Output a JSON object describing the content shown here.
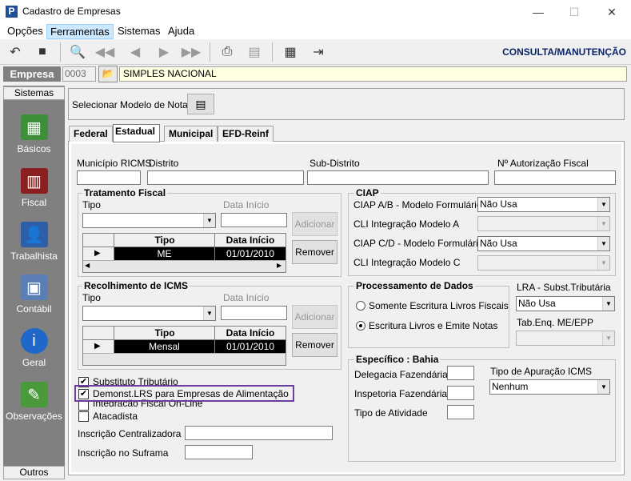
{
  "window": {
    "title": "Cadastro de Empresas",
    "minimize": "—",
    "maximize": "☐",
    "close": "✕"
  },
  "menu": [
    "Opções",
    "Ferramentas",
    "Sistemas",
    "Ajuda"
  ],
  "toolbar": {
    "mode": "CONSULTA/MANUTENÇÃO"
  },
  "empresa": {
    "label": "Empresa",
    "code": "0003",
    "name": "SIMPLES NACIONAL"
  },
  "sidebar": {
    "header": "Sistemas",
    "footer": "Outros",
    "items": [
      "Básicos",
      "Fiscal",
      "Trabalhista",
      "Contábil",
      "Geral",
      "Observações"
    ]
  },
  "modelo": {
    "label": "Selecionar Modelo de Nota"
  },
  "tabs": [
    "Federal",
    "Estadual",
    "Municipal",
    "EFD-Reinf"
  ],
  "fields": {
    "municipio_ricms": "Município RICMS",
    "distrito": "Distrito",
    "sub_distrito": "Sub-Distrito",
    "autorizacao": "Nº Autorização Fiscal"
  },
  "tratamento": {
    "title": "Tratamento Fiscal",
    "tipo": "Tipo",
    "data_inicio": "Data Início",
    "add": "Adicionar",
    "remove": "Remover",
    "col_tipo": "Tipo",
    "col_data": "Data Início",
    "row_tipo": "ME",
    "row_data": "01/01/2010"
  },
  "recolhimento": {
    "title": "Recolhimento de ICMS",
    "tipo": "Tipo",
    "data_inicio": "Data Início",
    "add": "Adicionar",
    "remove": "Remover",
    "col_tipo": "Tipo",
    "col_data": "Data Início",
    "row_tipo": "Mensal",
    "row_data": "01/01/2010"
  },
  "ciap": {
    "title": "CIAP",
    "ab_label": "CIAP  A/B - Modelo Formulário",
    "ab_value": "Não Usa",
    "cli_a": "CLI Integração Modelo A",
    "cd_label": "CIAP C/D - Modelo Formulário",
    "cd_value": "Não Usa",
    "cli_c": "CLI Integração Modelo C"
  },
  "processamento": {
    "title": "Processamento de Dados",
    "opt1": "Somente Escritura Livros Fiscais",
    "opt2": "Escritura Livros e Emite Notas"
  },
  "lra": {
    "label": "LRA - Subst.Tributária",
    "value": "Não Usa",
    "tab_label": "Tab.Enq. ME/EPP"
  },
  "especifico": {
    "title": "Específico : Bahia",
    "delegacia": "Delegacia Fazendária",
    "inspetoria": "Inspetoria Fazendária",
    "atividade": "Tipo de Atividade",
    "apuracao_label": "Tipo de Apuração ICMS",
    "apuracao_value": "Nenhum"
  },
  "checks": {
    "substituto": "Substituto Tributário",
    "demonst": "Demonst.LRS para Empresas de Alimentação",
    "integracao": "Integração Fiscal On-Line",
    "atacadista": "Atacadista"
  },
  "bottom": {
    "centralizadora": "Inscrição Centralizadora",
    "suframa": "Inscrição no Suframa"
  },
  "colors": {
    "highlight": "#6a3ea1",
    "mode": "#0a246a",
    "empresa_bg": "#7f7f7f",
    "name_bg": "#ffffe1"
  }
}
